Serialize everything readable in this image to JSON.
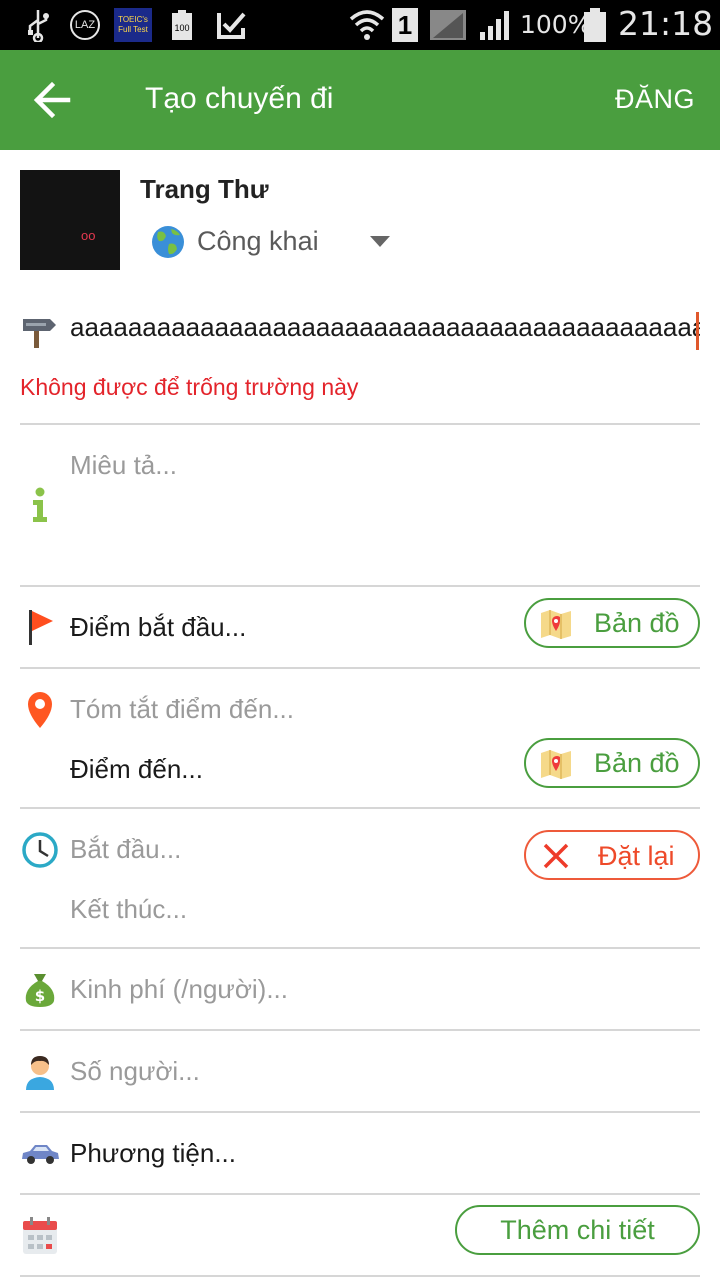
{
  "status_bar": {
    "carrier_icon_text": "LAZ",
    "app_icon_text": "TOEIC's Full Test",
    "battery_small_text": "100",
    "sim_label": "1",
    "battery_percent": "100%",
    "time": "21:18"
  },
  "app_bar": {
    "title": "Tạo chuyến đi",
    "post_label": "ĐĂNG"
  },
  "profile": {
    "name": "Trang Thư",
    "privacy": "Công khai",
    "avatar_mark": "oo"
  },
  "form": {
    "trip_name_value": "aaaaaaaaaaaaaaaaaaaaaaaaaaaaaaaaaaaaaaaaaaaaaaaa",
    "error_text": "Không được để trống trường này",
    "description_placeholder": "Miêu tả...",
    "start_point": "Điểm bắt đầu...",
    "map_label": "Bản đồ",
    "destination_summary_placeholder": "Tóm tắt điểm đến...",
    "destination": "Điểm đến...",
    "start_time_placeholder": "Bắt đầu...",
    "end_time_placeholder": "Kết thúc...",
    "reset_label": "Đặt lại",
    "budget_placeholder": "Kinh phí (/người)...",
    "people_placeholder": "Số người...",
    "vehicle": "Phương tiện...",
    "more_details_label": "Thêm chi tiết"
  },
  "colors": {
    "primary": "#4a9e3f",
    "error": "#e3242b",
    "reset": "#ee4a2a"
  }
}
